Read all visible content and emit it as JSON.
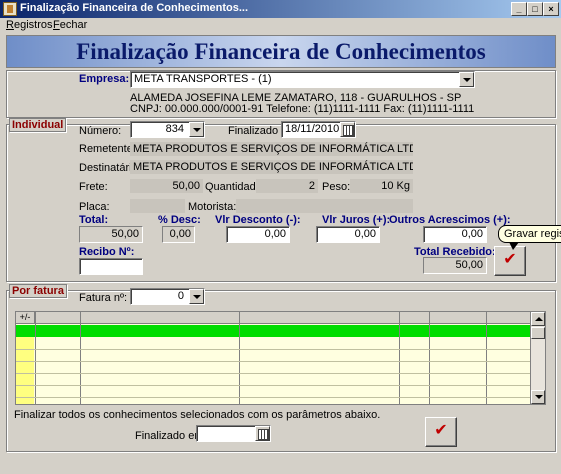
{
  "window": {
    "title": "Finalização Financeira de Conhecimentos..."
  },
  "menu": {
    "registros": "egistros",
    "registros_u": "R",
    "fechar": "echar",
    "fechar_u": "F"
  },
  "banner": {
    "title": "Finalização Financeira de Conhecimentos"
  },
  "empresa": {
    "label": "Empresa:",
    "value": "META TRANSPORTES - (1)",
    "address": "ALAMEDA JOSEFINA LEME ZAMATARO, 118 - GUARULHOS - SP",
    "contact": "CNPJ: 00.000.000/0001-91 Telefone: (11)1111-1111 Fax: (11)1111-1111"
  },
  "individual": {
    "legend": "Individual",
    "numero_label": "Número:",
    "numero_value": "834",
    "finalizado_label": "Finalizado em:",
    "finalizado_value": "18/11/2010",
    "remetente_label": "Remetente:",
    "remetente_value": "META PRODUTOS E SERVIÇOS DE INFORMÁTICA LTDA.",
    "destinatario_label": "Destinatário:",
    "destinatario_value": "META PRODUTOS E SERVIÇOS DE INFORMÁTICA LTDA.",
    "frete_label": "Frete:",
    "frete_value": "50,00",
    "quantidade_label": "Quantidade:",
    "quantidade_value": "2",
    "peso_label": "Peso:",
    "peso_value": "10 Kg",
    "placa_label": "Placa:",
    "placa_value": "",
    "motorista_label": "Motorista:",
    "motorista_value": "",
    "total_label": "Total:",
    "total_value": "50,00",
    "desc_label": "% Desc:",
    "desc_value": "0,00",
    "vlr_desconto_label": "Vlr Desconto (-):",
    "vlr_desconto_value": "0,00",
    "vlr_juros_label": "Vlr Juros (+):",
    "vlr_juros_value": "0,00",
    "outros_label": "Outros Acrescimos (+):",
    "outros_value": "0,00",
    "recibo_label": "Recibo Nº:",
    "recibo_value": "",
    "total_recebido_label": "Total Recebido:",
    "total_recebido_value": "50,00",
    "gravar_tooltip": "Gravar registro.",
    "gravar_icon": "checkmark-icon"
  },
  "por_fatura": {
    "legend": "Por fatura",
    "fatura_label": "Fatura nº:",
    "fatura_value": "0",
    "grid_header_first": "+/-",
    "instructions": "Finalizar todos os conhecimentos selecionados com os parâmetros abaixo.",
    "finalizado_label": "Finalizado em:",
    "finalizado_value": "",
    "confirm_icon": "checkmark-icon"
  },
  "colors": {
    "accent": "#8b0000",
    "grid_selected": "#00dd00",
    "grid_bg": "#ffffe0",
    "check": "#c00000"
  }
}
